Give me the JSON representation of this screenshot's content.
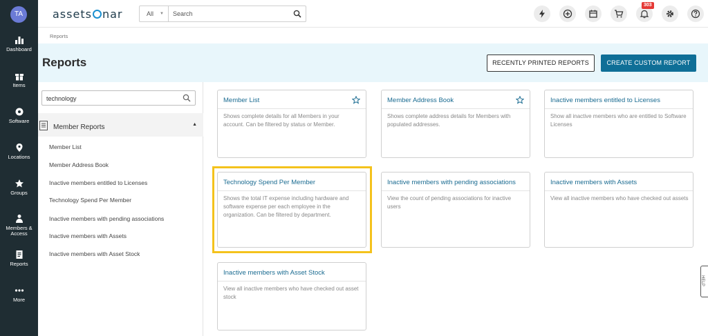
{
  "user": {
    "initials": "TA"
  },
  "nav": [
    {
      "label": "Dashboard",
      "icon": "dashboard-icon"
    },
    {
      "label": "Items",
      "icon": "gift-icon"
    },
    {
      "label": "Software",
      "icon": "software-icon"
    },
    {
      "label": "Locations",
      "icon": "map-pin-icon"
    },
    {
      "label": "Groups",
      "icon": "groups-icon"
    },
    {
      "label": "Members &",
      "label2": "Access",
      "icon": "members-icon"
    },
    {
      "label": "Reports",
      "icon": "reports-icon"
    },
    {
      "label": "More",
      "icon": "more-icon"
    }
  ],
  "topbar": {
    "logo": "assetsonar",
    "logo_left": "assets",
    "logo_right": "nar",
    "search_scope": "All",
    "search_placeholder": "Search",
    "notification_count": "303"
  },
  "breadcrumb": "Reports",
  "header": {
    "title": "Reports",
    "recent_button": "RECENTLY PRINTED REPORTS",
    "create_button": "CREATE CUSTOM REPORT"
  },
  "sidebar": {
    "filter_value": "technology",
    "group": "Member Reports",
    "items": [
      "Member List",
      "Member Address Book",
      "Inactive members entitled to Licenses",
      "Technology Spend Per Member",
      "Inactive members with pending associations",
      "Inactive members with Assets",
      "Inactive members with Asset Stock"
    ]
  },
  "cards": [
    {
      "title": "Member List",
      "desc": "Shows complete details for all Members in your account. Can be filtered by status or Member.",
      "starred": true
    },
    {
      "title": "Member Address Book",
      "desc": "Shows complete address details for Members with populated addresses.",
      "starred": true
    },
    {
      "title": "Inactive members entitled to Licenses",
      "desc": "Show all inactive members who are entitled to Software Licenses",
      "starred": false
    },
    {
      "title": "Technology Spend Per Member",
      "desc": "Shows the total IT expense including hardware and software expense per each employee in the organization. Can be filtered by department.",
      "starred": false
    },
    {
      "title": "Inactive members with pending associations",
      "desc": "View the count of pending associations for inactive users",
      "starred": false
    },
    {
      "title": "Inactive members with Assets",
      "desc": "View all inactive members who have checked out assets",
      "starred": false
    },
    {
      "title": "Inactive members with Asset Stock",
      "desc": "View all inactive members who have checked out asset stock",
      "starred": false
    }
  ],
  "help_tab": "HELP",
  "colors": {
    "nav_bg": "#1f2d33",
    "accent": "#0f6f97",
    "link": "#1a6b91",
    "highlight": "#f4c21c",
    "header_band": "#e8f6fb"
  }
}
